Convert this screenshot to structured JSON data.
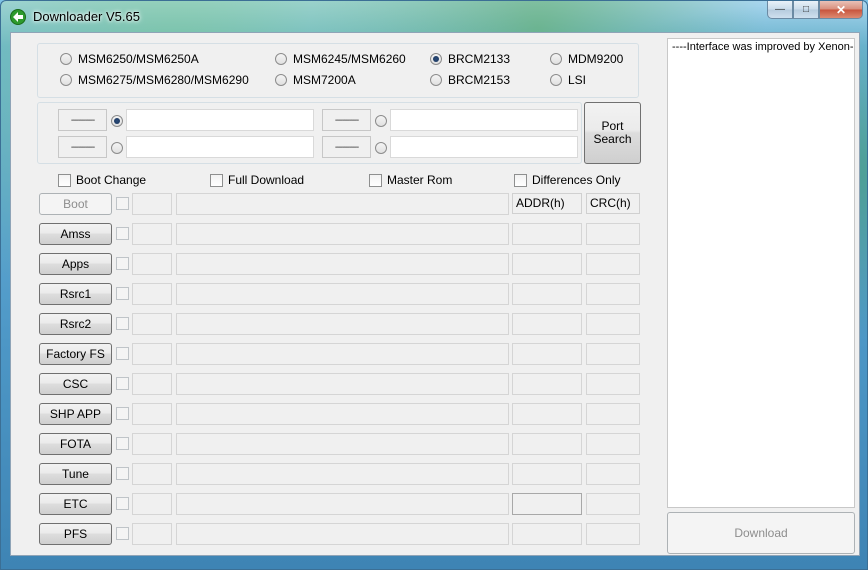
{
  "window": {
    "title": "Downloader V5.65"
  },
  "chipsets": [
    {
      "label": "MSM6250/MSM6250A",
      "selected": false
    },
    {
      "label": "MSM6245/MSM6260",
      "selected": false
    },
    {
      "label": "BRCM2133",
      "selected": true
    },
    {
      "label": "MDM9200",
      "selected": false
    },
    {
      "label": "MSM6275/MSM6280/MSM6290",
      "selected": false
    },
    {
      "label": "MSM7200A",
      "selected": false
    },
    {
      "label": "BRCM2153",
      "selected": false
    },
    {
      "label": "LSI",
      "selected": false
    }
  ],
  "ports": {
    "placeholder": "----------",
    "port_search_label_1": "Port",
    "port_search_label_2": "Search"
  },
  "options": {
    "boot_change": "Boot Change",
    "full_download": "Full Download",
    "master_rom": "Master Rom",
    "differences_only": "Differences Only"
  },
  "columns": {
    "addr": "ADDR(h)",
    "crc": "CRC(h)"
  },
  "rows": [
    {
      "label": "Boot",
      "enabled": false
    },
    {
      "label": "Amss",
      "enabled": true
    },
    {
      "label": "Apps",
      "enabled": true
    },
    {
      "label": "Rsrc1",
      "enabled": true
    },
    {
      "label": "Rsrc2",
      "enabled": true
    },
    {
      "label": "Factory FS",
      "enabled": true
    },
    {
      "label": "CSC",
      "enabled": true
    },
    {
      "label": "SHP APP",
      "enabled": true
    },
    {
      "label": "FOTA",
      "enabled": true
    },
    {
      "label": "Tune",
      "enabled": true
    },
    {
      "label": "ETC",
      "enabled": true
    },
    {
      "label": "PFS",
      "enabled": true
    }
  ],
  "log": {
    "text": "----Interface was improved by Xenon----"
  },
  "download_label": "Download"
}
